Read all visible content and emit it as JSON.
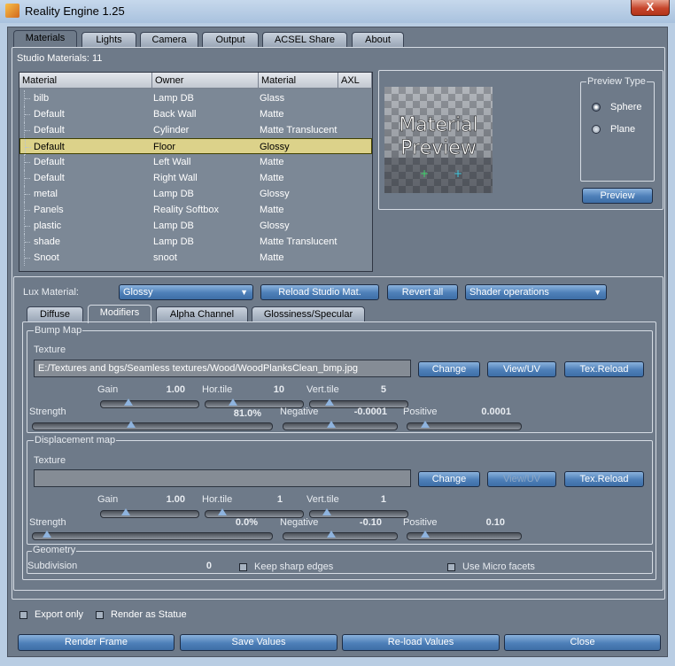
{
  "window": {
    "title": "Reality Engine 1.25",
    "close_label": "X"
  },
  "tabs": [
    "Materials",
    "Lights",
    "Camera",
    "Output",
    "ACSEL Share",
    "About"
  ],
  "studio_materials_label": "Studio Materials: 11",
  "table": {
    "headers": [
      "Material",
      "Owner",
      "Material",
      "AXL"
    ],
    "rows": [
      {
        "name": "bilb",
        "owner": "Lamp DB",
        "type": "Glass"
      },
      {
        "name": "Default",
        "owner": "Back Wall",
        "type": "Matte"
      },
      {
        "name": "Default",
        "owner": "Cylinder",
        "type": "Matte Translucent"
      },
      {
        "name": "Default",
        "owner": "Floor",
        "type": "Glossy"
      },
      {
        "name": "Default",
        "owner": "Left Wall",
        "type": "Matte"
      },
      {
        "name": "Default",
        "owner": "Right Wall",
        "type": "Matte"
      },
      {
        "name": "metal",
        "owner": "Lamp DB",
        "type": "Glossy"
      },
      {
        "name": "Panels",
        "owner": "Reality Softbox",
        "type": "Matte"
      },
      {
        "name": "plastic",
        "owner": "Lamp DB",
        "type": "Glossy"
      },
      {
        "name": "shade",
        "owner": "Lamp DB",
        "type": "Matte Translucent"
      },
      {
        "name": "Snoot",
        "owner": "snoot",
        "type": "Matte"
      }
    ]
  },
  "preview": {
    "image_line1": "Material",
    "image_line2": "Preview",
    "type_legend": "Preview Type",
    "options": [
      "Sphere",
      "Plane"
    ],
    "selected_option": "Sphere",
    "button": "Preview"
  },
  "lux": {
    "label": "Lux Material:",
    "value": "Glossy",
    "reload_button": "Reload Studio Mat.",
    "revert_button": "Revert all",
    "shader_ops": "Shader operations"
  },
  "subtabs": [
    "Diffuse",
    "Modifiers",
    "Alpha Channel",
    "Glossiness/Specular"
  ],
  "bump": {
    "legend": "Bump Map",
    "texture_label": "Texture",
    "texture_path": "E:/Textures and bgs/Seamless textures/Wood/WoodPlanksClean_bmp.jpg",
    "change": "Change",
    "view": "View/UV",
    "reload": "Tex.Reload",
    "gain_label": "Gain",
    "gain": "1.00",
    "htile_label": "Hor.tile",
    "htile": "10",
    "vtile_label": "Vert.tile",
    "vtile": "5",
    "strength_label": "Strength",
    "strength": "81.0%",
    "negative_label": "Negative",
    "negative": "-0.0001",
    "positive_label": "Positive",
    "positive": "0.0001",
    "gain_pos": 0.28,
    "htile_pos": 0.28,
    "vtile_pos": 0.2,
    "strength_pos": 0.41,
    "negative_pos": 0.42,
    "positive_pos": 0.16
  },
  "displacement": {
    "legend": "Displacement map",
    "texture_label": "Texture",
    "texture_path": "",
    "change": "Change",
    "view": "View/UV",
    "reload": "Tex.Reload",
    "gain_label": "Gain",
    "gain": "1.00",
    "htile_label": "Hor.tile",
    "htile": "1",
    "vtile_label": "Vert.tile",
    "vtile": "1",
    "strength_label": "Strength",
    "strength": "0.0%",
    "negative_label": "Negative",
    "negative": "-0.10",
    "positive_label": "Positive",
    "positive": "0.10",
    "gain_pos": 0.25,
    "htile_pos": 0.17,
    "vtile_pos": 0.17,
    "strength_pos": 0.06,
    "negative_pos": 0.42,
    "positive_pos": 0.16
  },
  "geometry": {
    "legend": "Geometry",
    "subdivision_label": "Subdivision",
    "subdivision": "0",
    "keep_sharp": "Keep sharp edges",
    "micro_facets": "Use Micro facets"
  },
  "bottom": {
    "export_only": "Export only",
    "render_statue": "Render as Statue",
    "buttons": [
      "Render Frame",
      "Save Values",
      "Re-load Values",
      "Close"
    ]
  }
}
